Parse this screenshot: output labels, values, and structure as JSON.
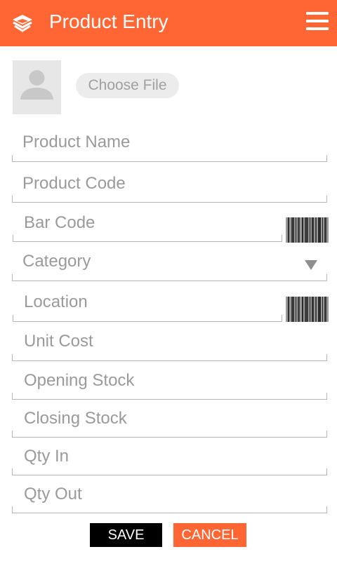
{
  "header": {
    "title": "Product Entry",
    "logo_icon": "layers-logo-icon",
    "menu_icon": "hamburger-menu-icon"
  },
  "image_picker": {
    "avatar_icon": "user-placeholder-icon",
    "choose_file_label": "Choose File"
  },
  "fields": {
    "product_name": "Product Name",
    "product_code": "Product Code",
    "bar_code": "Bar Code",
    "category": "Category",
    "location": "Location",
    "unit_cost": "Unit Cost",
    "opening_stock": "Opening Stock",
    "closing_stock": "Closing Stock",
    "qty_in": "Qty In",
    "qty_out": "Qty Out"
  },
  "buttons": {
    "save": "SAVE",
    "cancel": "CANCEL"
  },
  "colors": {
    "accent": "#ff6633",
    "label_gray": "#9a9a9a",
    "save_bg": "#000000"
  }
}
